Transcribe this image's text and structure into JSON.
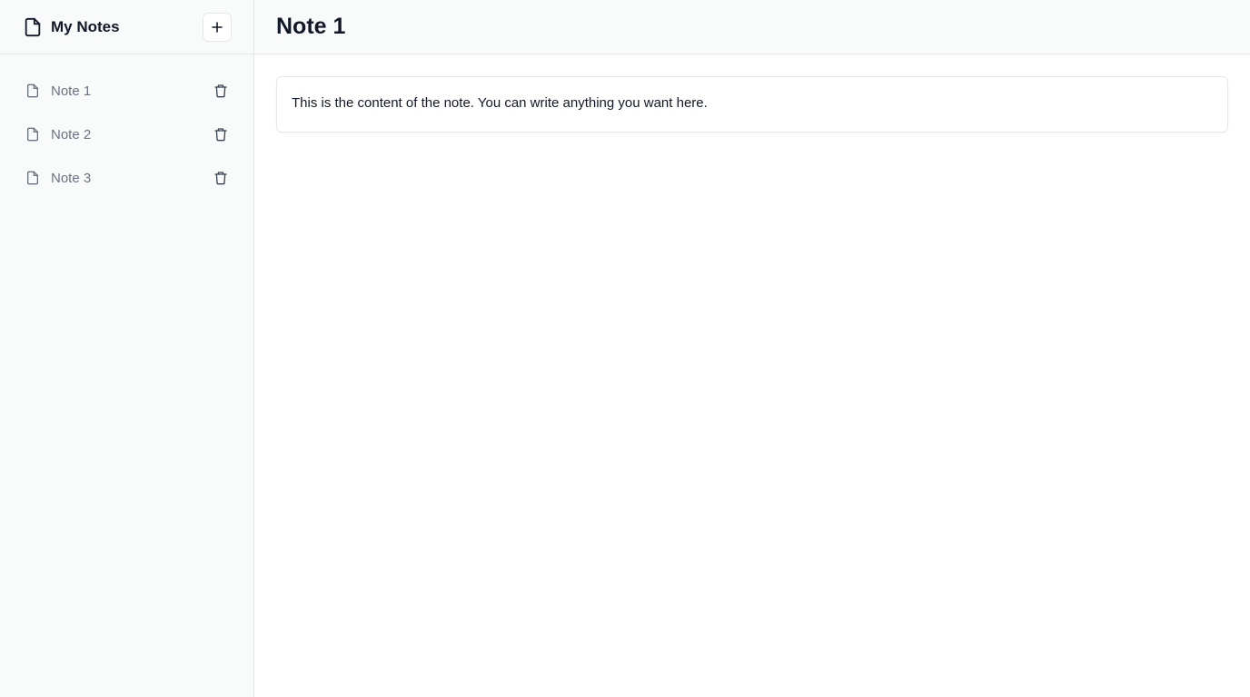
{
  "sidebar": {
    "brand_icon": "file-icon",
    "title": "My Notes",
    "add_button_label": "+",
    "items": [
      {
        "label": "Note 1",
        "icon": "file-icon",
        "action_icon": "trash-icon"
      },
      {
        "label": "Note 2",
        "icon": "file-icon",
        "action_icon": "trash-icon"
      },
      {
        "label": "Note 3",
        "icon": "file-icon",
        "action_icon": "trash-icon"
      }
    ]
  },
  "main": {
    "title": "Note 1",
    "content": "This is the content of the note. You can write anything you want here."
  },
  "colors": {
    "sidebar_bg": "#f9fafa",
    "border": "#e5e7eb",
    "text_primary": "#111827",
    "text_muted": "#6b7280"
  }
}
